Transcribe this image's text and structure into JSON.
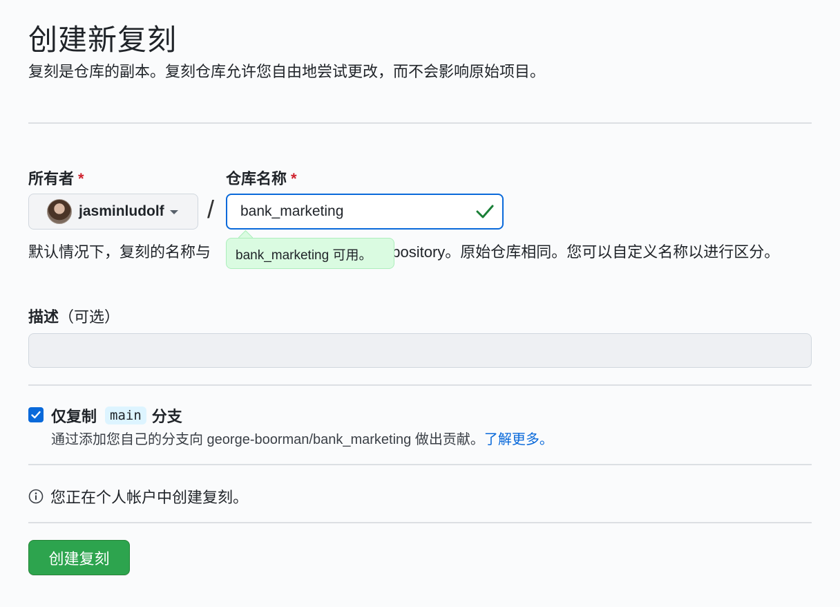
{
  "header": {
    "title": "创建新复刻",
    "subtitle": "复刻是仓库的副本。复刻仓库允许您自由地尝试更改，而不会影响原始项目。"
  },
  "form": {
    "owner_label": "所有者",
    "repo_label": "仓库名称",
    "required_mark": "*",
    "owner_value": "jasminludolf",
    "slash": "/",
    "repo_value": "bank_marketing",
    "availability_tooltip": "bank_marketing 可用。",
    "name_help_visible": "默认情况下，复刻的名称与",
    "name_help_rest": "epository。原始仓库相同。您可以自定义名称以进行区分。",
    "description_label": "描述",
    "description_optional": "（可选）",
    "description_value": ""
  },
  "copy_branch": {
    "checked": true,
    "label_prefix": "仅复制",
    "branch_name": "main",
    "label_suffix": "分支",
    "description": "通过添加您自己的分支向 george-boorman/bank_marketing 做出贡献。",
    "learn_more": "了解更多。"
  },
  "info": {
    "text": "您正在个人帐户中创建复刻。"
  },
  "actions": {
    "create_label": "创建复刻"
  },
  "colors": {
    "primary_button": "#2da44e",
    "accent_blue": "#0969da",
    "success_check": "#1a7f37",
    "tooltip_bg": "#dafbe1",
    "required_red": "#cf222e"
  },
  "icons": {
    "valid": "check-icon",
    "info": "info-icon",
    "dropdown": "caret-down-icon"
  }
}
